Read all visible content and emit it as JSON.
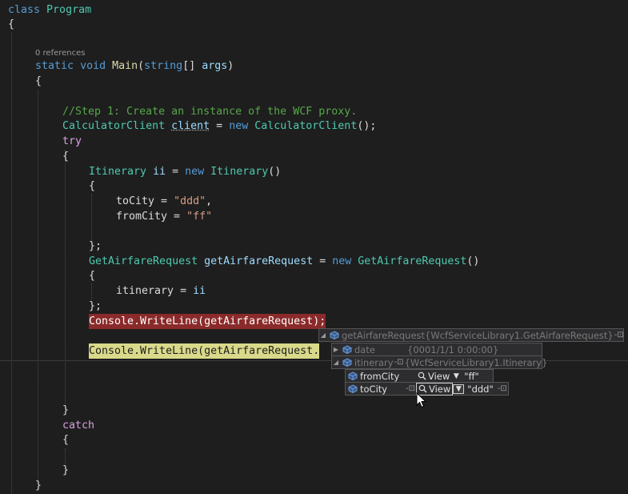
{
  "codelens": {
    "references": "0 references"
  },
  "code": {
    "l1_class": "class",
    "l1_name": "Program",
    "l2": "{",
    "l4_static": "static",
    "l4_void": "void",
    "l4_main": "Main",
    "l4_open": "(",
    "l4_string": "string",
    "l4_arr": "[] ",
    "l4_args": "args",
    "l4_close": ")",
    "l5": "{",
    "l6_comment": "//Step 1: Create an instance of the WCF proxy.",
    "l7_type": "CalculatorClient",
    "l7_var": "client",
    "l7_eq": " = ",
    "l7_new": "new",
    "l7_ctor": "CalculatorClient",
    "l7_end": "();",
    "l8_try": "try",
    "l9": "{",
    "l10_type": "Itinerary",
    "l10_var": "ii",
    "l10_eq": " = ",
    "l10_new": "new",
    "l10_ctor": "Itinerary",
    "l10_end": "()",
    "l11": "{",
    "l12_prop": "toCity",
    "l12_eq": " = ",
    "l12_val": "\"ddd\"",
    "l12_end": ",",
    "l13_prop": "fromCity",
    "l13_eq": " = ",
    "l13_val": "\"ff\"",
    "l15": "};",
    "l16_type": "GetAirfareRequest",
    "l16_var": "getAirfareRequest",
    "l16_eq": " = ",
    "l16_new": "new",
    "l16_ctor": "GetAirfareRequest",
    "l16_end": "()",
    "l17": "{",
    "l18_prop": "itinerary",
    "l18_eq": " = ",
    "l18_val": "ii",
    "l19": "};",
    "l20_stmt": "Console.WriteLine(getAirfareRequest);",
    "l21_stmt": "Console.WriteLine(getAirfareRequest.",
    "l22": "}",
    "l23_catch": "catch",
    "l24": "{",
    "l25": "}",
    "l26": "}"
  },
  "datatip": {
    "root": {
      "name": "getAirfareRequest",
      "value": "{WcfServiceLibrary1.GetAirfareRequest}"
    },
    "date": {
      "name": "date",
      "value": "{0001/1/1 0:00:00}"
    },
    "itinerary": {
      "name": "itinerary",
      "value": "{WcfServiceLibrary1.Itinerary}"
    },
    "fromCity": {
      "name": "fromCity",
      "view": "View",
      "value": "\"ff\""
    },
    "toCity": {
      "name": "toCity",
      "view": "View",
      "value": "\"ddd\""
    }
  },
  "icons": [
    "field-cube-icon",
    "expand-arrow-icon",
    "pin-icon",
    "magnifier-icon",
    "dropdown-arrow-icon",
    "mouse-pointer-icon"
  ]
}
